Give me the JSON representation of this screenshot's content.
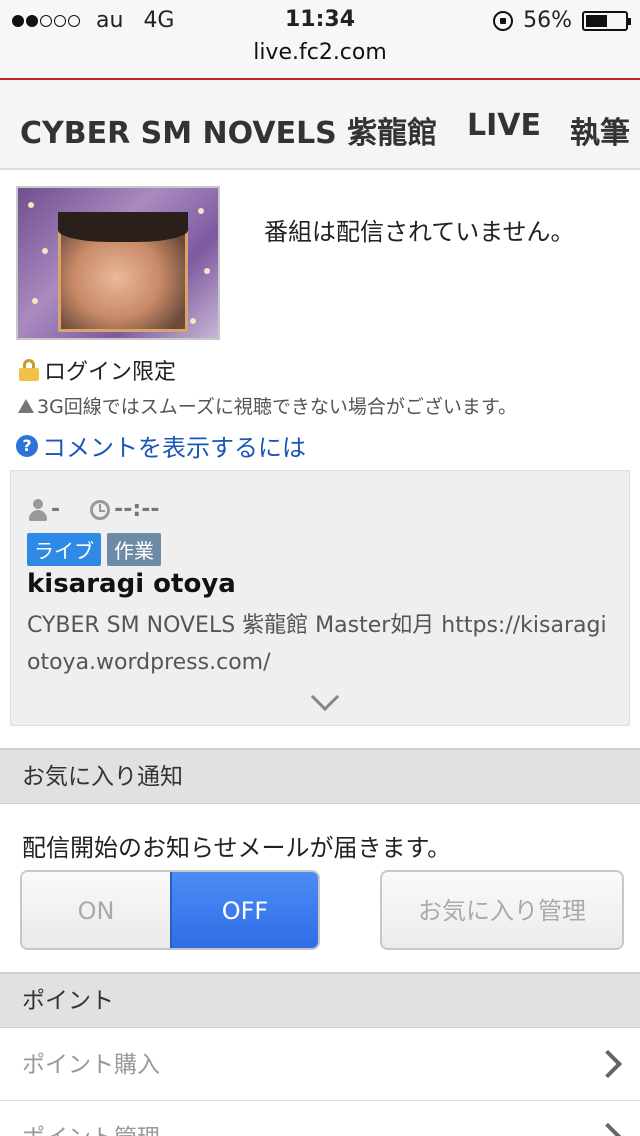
{
  "status_bar": {
    "carrier": "au",
    "network": "4G",
    "time": "11:34",
    "battery": "56%",
    "battery_level": 0.56,
    "signal_bars": 2
  },
  "url": "live.fc2.com",
  "nav": {
    "items": [
      "CYBER SM NOVELS 紫龍館",
      "LIVE",
      "執筆"
    ]
  },
  "channel": {
    "offline_message": "番組は配信されていません。",
    "login_only": "ログイン限定",
    "warning": "3G回線ではスムーズに視聴できない場合がございます。",
    "comment_help": "コメントを表示するには"
  },
  "card": {
    "viewers": "-",
    "duration": "--:--",
    "tags": [
      "ライブ",
      "作業"
    ],
    "host_name": "kisaragi otoya",
    "description": "CYBER SM NOVELS 紫龍館 Master如月 https://kisaragiotoya.wordpress.com/"
  },
  "favorites": {
    "section_title": "お気に入り通知",
    "info": "配信開始のお知らせメールが届きます。",
    "on_label": "ON",
    "off_label": "OFF",
    "selected": "OFF",
    "manage_label": "お気に入り管理"
  },
  "points": {
    "section_title": "ポイント",
    "items": [
      "ポイント購入",
      "ポイント管理"
    ]
  },
  "colors": {
    "accent_red": "#b9272c",
    "toggle_active": "#2f6ee6",
    "link_blue": "#1a56b8",
    "tag_live": "#2e8ae6",
    "tag_work": "#6d8aa6"
  }
}
